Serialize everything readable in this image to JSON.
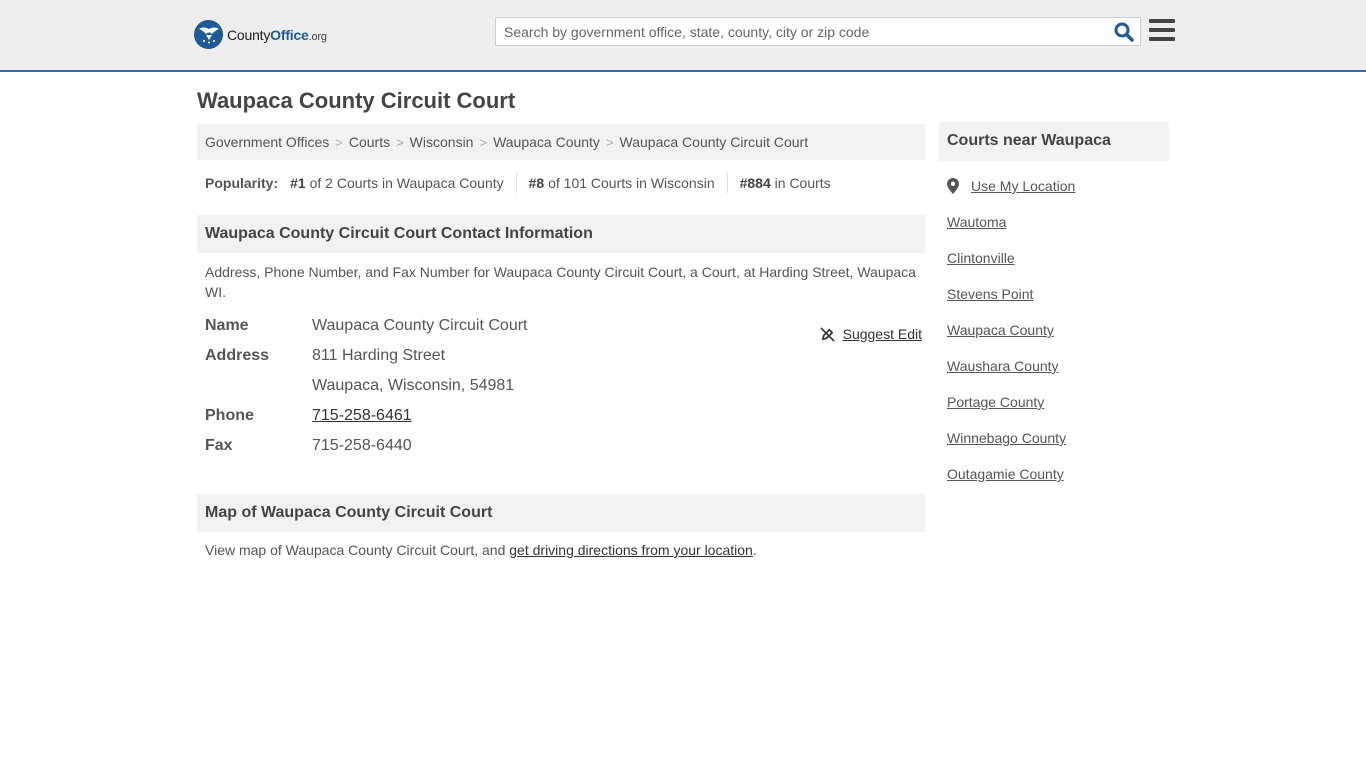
{
  "header": {
    "logo": {
      "part1": "County",
      "part2": "Office",
      "part3": ".org"
    },
    "search_placeholder": "Search by government office, state, county, city or zip code"
  },
  "page_title": "Waupaca County Circuit Court",
  "breadcrumb": [
    "Government Offices",
    "Courts",
    "Wisconsin",
    "Waupaca County",
    "Waupaca County Circuit Court"
  ],
  "popularity": {
    "label": "Popularity:",
    "items": [
      {
        "rank": "#1",
        "text": " of 2 Courts in Waupaca County"
      },
      {
        "rank": "#8",
        "text": " of 101 Courts in Wisconsin"
      },
      {
        "rank": "#884",
        "text": " in Courts"
      }
    ]
  },
  "contact": {
    "heading": "Waupaca County Circuit Court Contact Information",
    "description": "Address, Phone Number, and Fax Number for Waupaca County Circuit Court, a Court, at Harding Street, Waupaca WI.",
    "suggest_edit": "Suggest Edit",
    "fields": {
      "name_label": "Name",
      "name": "Waupaca County Circuit Court",
      "address_label": "Address",
      "address_line1": "811 Harding Street",
      "address_line2": "Waupaca, Wisconsin, 54981",
      "phone_label": "Phone",
      "phone": "715-258-6461",
      "fax_label": "Fax",
      "fax": "715-258-6440"
    }
  },
  "map": {
    "heading": "Map of Waupaca County Circuit Court",
    "text": "View map of Waupaca County Circuit Court, and ",
    "link": "get driving directions from your location",
    "end": "."
  },
  "sidebar": {
    "heading": "Courts near Waupaca",
    "use_location": "Use My Location",
    "items": [
      "Wautoma",
      "Clintonville",
      "Stevens Point",
      "Waupaca County",
      "Waushara County",
      "Portage County",
      "Winnebago County",
      "Outagamie County"
    ]
  },
  "colors": {
    "accent": "#2c6dae",
    "brand": "#1d5a96",
    "panel": "#f2f2f2"
  }
}
